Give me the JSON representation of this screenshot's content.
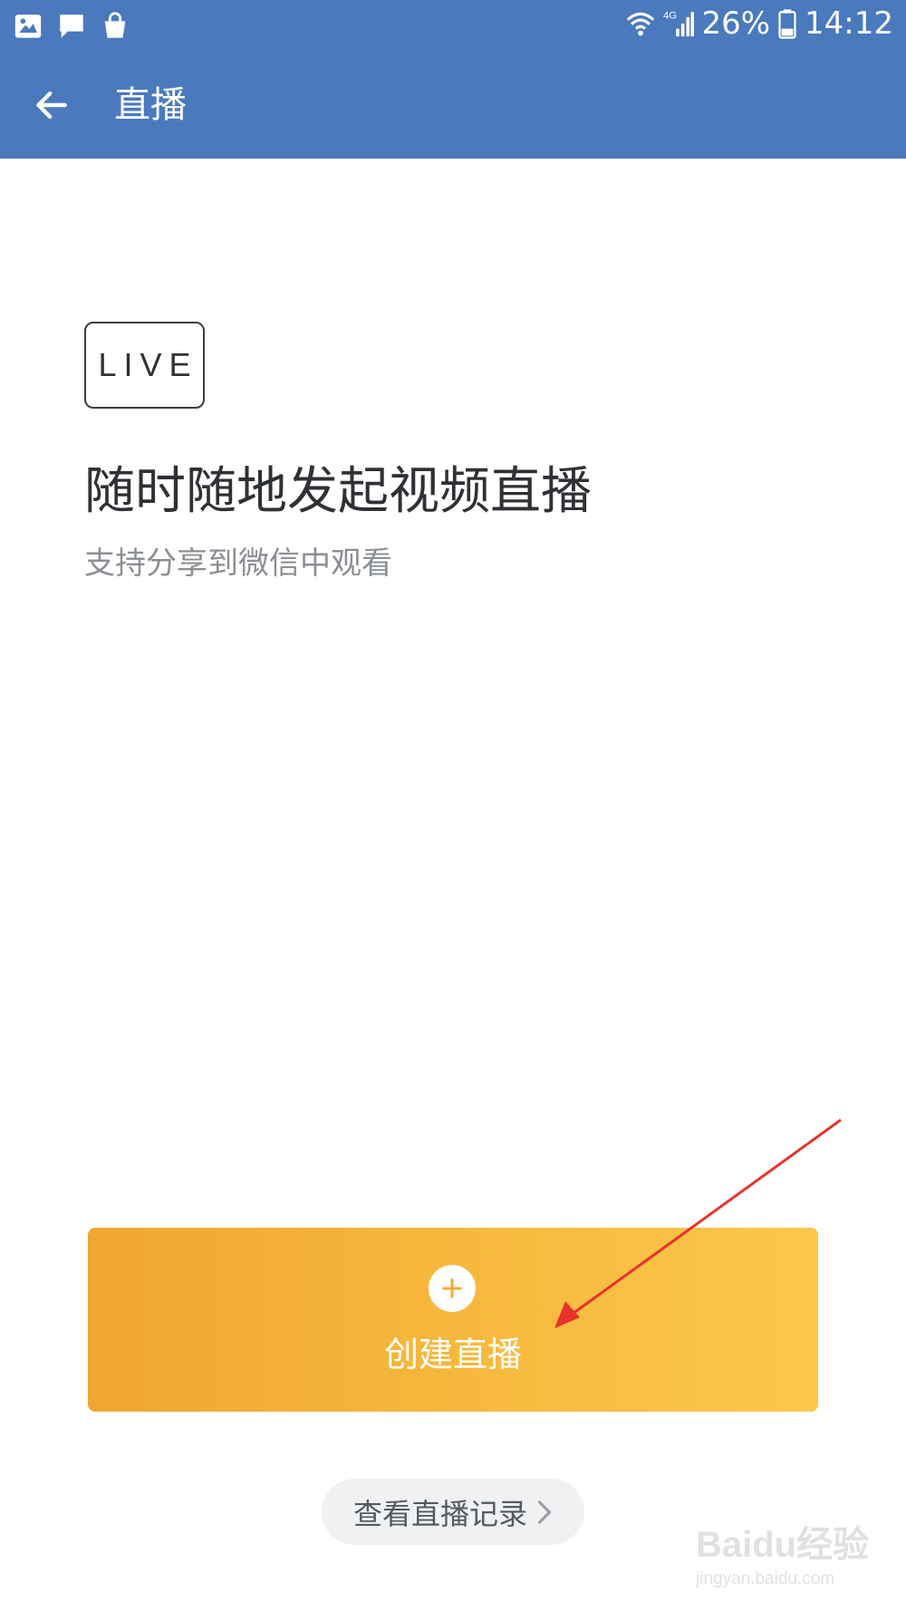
{
  "status_bar": {
    "icons_left": [
      "gallery-icon",
      "message-icon",
      "shopping-bag-icon"
    ],
    "network": "4G",
    "battery_percent": "26%",
    "time": "14:12"
  },
  "app_bar": {
    "back_icon": "arrow-left-icon",
    "title": "直播"
  },
  "content": {
    "badge_text": "LIVE",
    "headline": "随时随地发起视频直播",
    "subline": "支持分享到微信中观看"
  },
  "create_button": {
    "icon": "plus-icon",
    "label": "创建直播"
  },
  "records_button": {
    "label": "查看直播记录",
    "icon": "chevron-right-icon"
  },
  "watermark": {
    "brand": "Baidu经验",
    "url": "jingyan.baidu.com"
  },
  "colors": {
    "app_bar": "#4a79be",
    "button_gradient_start": "#f0a630",
    "button_gradient_end": "#fcc84a",
    "annotation_arrow": "#e8322b"
  }
}
